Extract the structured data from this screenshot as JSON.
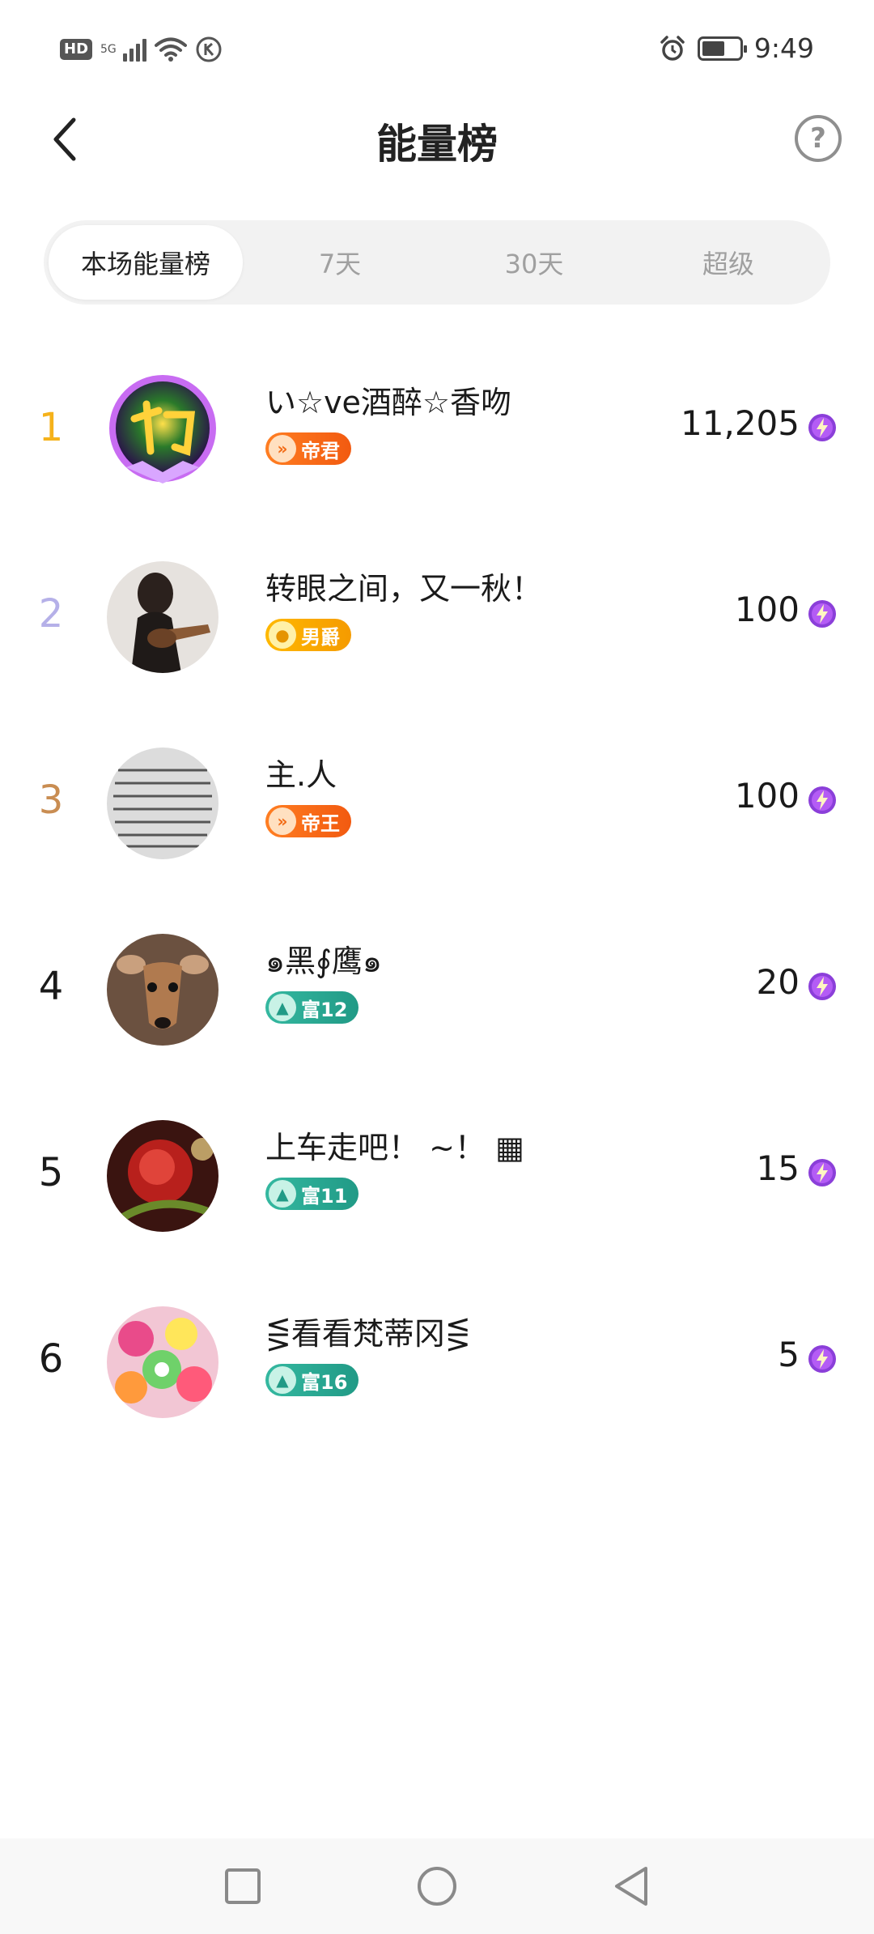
{
  "status_bar": {
    "hd": "HD",
    "network": "5G",
    "time": "9:49",
    "icons": [
      "hd-icon",
      "signal-icon",
      "wifi-icon",
      "k-icon",
      "alarm-icon",
      "battery-icon"
    ]
  },
  "header": {
    "title": "能量榜",
    "help": "?"
  },
  "tabs": [
    {
      "label": "本场能量榜",
      "active": true
    },
    {
      "label": "7天",
      "active": false
    },
    {
      "label": "30天",
      "active": false
    },
    {
      "label": "超级",
      "active": false
    }
  ],
  "ranking": [
    {
      "rank": "1",
      "name": "い☆ve酒醉☆香吻",
      "badge": "帝君",
      "badge_style": "orange",
      "score": "11,205",
      "rank_color": "#f5b21b"
    },
    {
      "rank": "2",
      "name": "转眼之间，又一秋！",
      "badge": "男爵",
      "badge_style": "gold",
      "score": "100",
      "rank_color": "#b5b0e8"
    },
    {
      "rank": "3",
      "name": "主.人",
      "badge": "帝王",
      "badge_style": "orange",
      "score": "100",
      "rank_color": "#c98d52"
    },
    {
      "rank": "4",
      "name": "๑黑∮鹰๑",
      "badge": "富12",
      "badge_style": "teal",
      "score": "20",
      "rank_color": "#1a1a1a"
    },
    {
      "rank": "5",
      "name": "上车走吧！ ~！ ▦",
      "badge": "富11",
      "badge_style": "teal",
      "score": "15",
      "rank_color": "#1a1a1a"
    },
    {
      "rank": "6",
      "name": "⋚看看梵蒂冈⋚",
      "badge": "富16",
      "badge_style": "teal",
      "score": "5",
      "rank_color": "#1a1a1a"
    }
  ],
  "colors": {
    "accent_purple": "#8b3fd9",
    "tab_bg": "#f2f2f2",
    "rank1": "#f5b21b",
    "rank2": "#b5b0e8",
    "rank3": "#c98d52"
  },
  "nav_bar": {
    "icons": [
      "recent-apps-icon",
      "home-icon",
      "back-icon"
    ]
  }
}
